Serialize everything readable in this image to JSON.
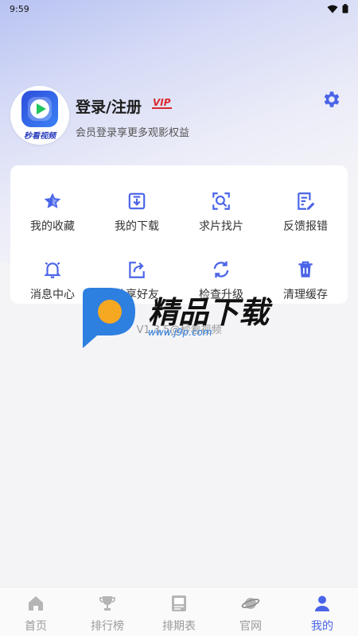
{
  "status_bar": {
    "time": "9:59"
  },
  "profile": {
    "title": "登录/注册",
    "vip": "VIP",
    "subtitle": "会员登录享更多观影权益",
    "avatar_caption": "秒看视频"
  },
  "colors": {
    "accent": "#4a64e8",
    "vip": "#d9282f"
  },
  "grid": {
    "items": [
      {
        "label": "我的收藏",
        "icon": "star-icon"
      },
      {
        "label": "我的下载",
        "icon": "download-icon"
      },
      {
        "label": "求片找片",
        "icon": "search-scan-icon"
      },
      {
        "label": "反馈报错",
        "icon": "feedback-edit-icon"
      },
      {
        "label": "消息中心",
        "icon": "bell-icon"
      },
      {
        "label": "分享好友",
        "icon": "share-icon"
      },
      {
        "label": "检查升级",
        "icon": "refresh-icon"
      },
      {
        "label": "清理缓存",
        "icon": "trash-icon"
      }
    ]
  },
  "version": "V1.3.5@秒看视频",
  "watermark": {
    "text": "精品下载",
    "url": "www.j9p.com"
  },
  "tabs": [
    {
      "label": "首页",
      "icon": "home-icon"
    },
    {
      "label": "排行榜",
      "icon": "trophy-icon"
    },
    {
      "label": "排期表",
      "icon": "schedule-icon"
    },
    {
      "label": "官网",
      "icon": "planet-icon"
    },
    {
      "label": "我的",
      "icon": "user-icon"
    }
  ]
}
